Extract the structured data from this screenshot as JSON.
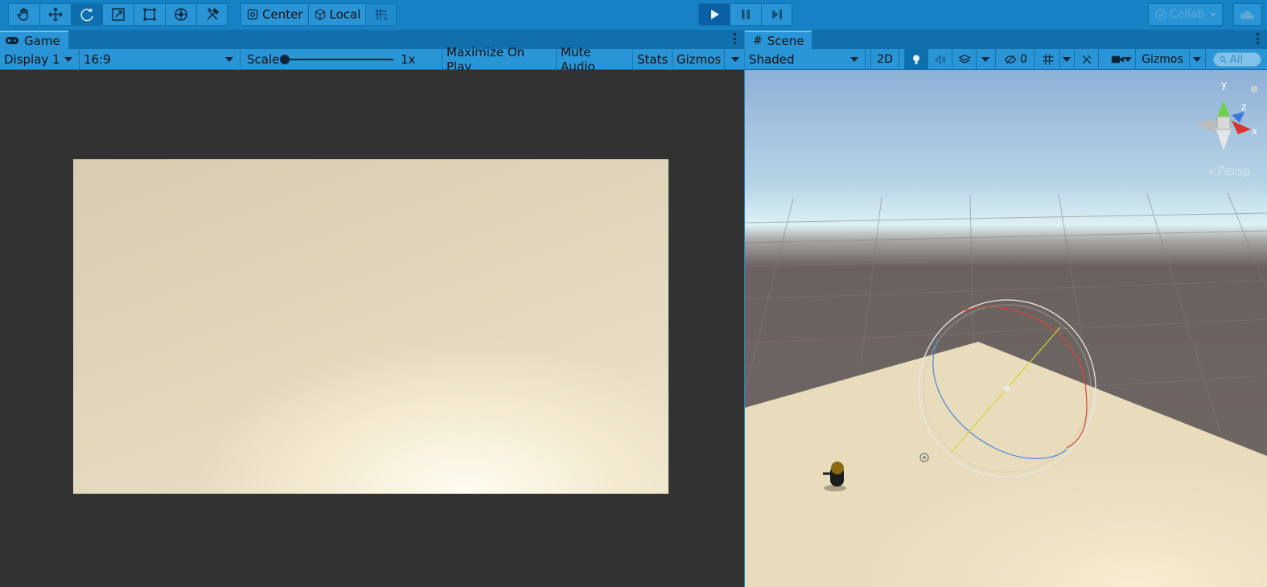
{
  "toolbar": {
    "tools": [
      {
        "name": "hand-tool",
        "icon": "hand-icon"
      },
      {
        "name": "move-tool",
        "icon": "move-icon"
      },
      {
        "name": "rotate-tool",
        "icon": "rotate-icon",
        "active": true
      },
      {
        "name": "scale-tool",
        "icon": "scale-icon"
      },
      {
        "name": "rect-tool",
        "icon": "rect-icon"
      },
      {
        "name": "transform-tool",
        "icon": "transform-icon"
      },
      {
        "name": "custom-tool",
        "icon": "tools-icon"
      }
    ],
    "pivot_label": "Center",
    "space_label": "Local",
    "collab_label": "Collab",
    "accent": "#1681c4",
    "play_active_color": "#0b5fa5"
  },
  "game": {
    "tab_label": "Game",
    "display_label": "Display 1",
    "aspect_label": "16:9",
    "scale_label": "Scale",
    "scale_value": "1x",
    "scale_level": 0.0,
    "maximize_label": "Maximize On Play",
    "mute_label": "Mute Audio",
    "stats_label": "Stats",
    "gizmos_label": "Gizmos"
  },
  "scene": {
    "tab_label": "Scene",
    "shading_label": "Shaded",
    "mode_2d_label": "2D",
    "hidden_count": "0",
    "gizmos_label": "Gizmos",
    "search_placeholder": "All",
    "view_label": "Persp",
    "axis_labels": {
      "y": "y",
      "z": "z",
      "x": "x"
    }
  }
}
